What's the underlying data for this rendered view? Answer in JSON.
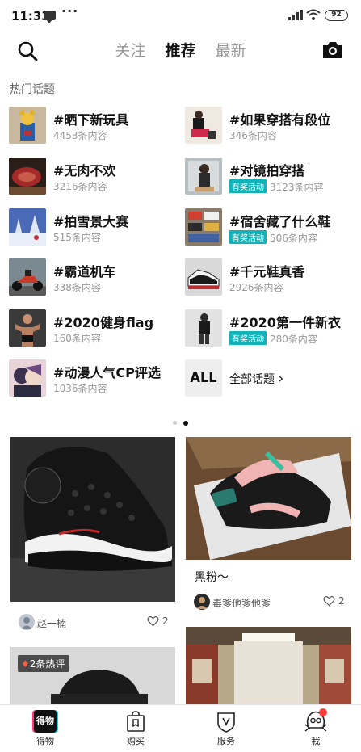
{
  "status_bar": {
    "time": "11:33",
    "dots": "···",
    "battery": "92"
  },
  "header": {
    "tabs": [
      {
        "label": "关注",
        "active": false
      },
      {
        "label": "推荐",
        "active": true
      },
      {
        "label": "最新",
        "active": false
      }
    ]
  },
  "hot_topics": {
    "section_label": "热门话题",
    "items": [
      {
        "title": "#晒下新玩具",
        "count": "4453条内容",
        "reward": ""
      },
      {
        "title": "#如果穿搭有段位",
        "count": "346条内容",
        "reward": ""
      },
      {
        "title": "#无肉不欢",
        "count": "3216条内容",
        "reward": ""
      },
      {
        "title": "#对镜拍穿搭",
        "count": "3123条内容",
        "reward": "有奖活动"
      },
      {
        "title": "#拍雪景大赛",
        "count": "515条内容",
        "reward": ""
      },
      {
        "title": "#宿舍藏了什么鞋",
        "count": "506条内容",
        "reward": "有奖活动"
      },
      {
        "title": "#霸道机车",
        "count": "338条内容",
        "reward": ""
      },
      {
        "title": "#千元鞋真香",
        "count": "2926条内容",
        "reward": ""
      },
      {
        "title": "#2020健身flag",
        "count": "160条内容",
        "reward": ""
      },
      {
        "title": "#2020第一件新衣",
        "count": "280条内容",
        "reward": "有奖活动"
      },
      {
        "title": "#动漫人气CP评选",
        "count": "1036条内容",
        "reward": ""
      }
    ],
    "all": {
      "badge": "ALL",
      "label": "全部话题",
      "chevron": "›"
    }
  },
  "feed": {
    "cards": [
      {
        "caption": "",
        "author": "赵一楠",
        "likes": "2"
      },
      {
        "caption": "黑粉～",
        "author": "毒爹他爹他爹",
        "likes": "2"
      },
      {
        "caption": "",
        "hot_tag": "2条热评"
      }
    ]
  },
  "bottom_nav": {
    "items": [
      {
        "label": "得物",
        "icon": "dewu-logo-icon"
      },
      {
        "label": "购买",
        "icon": "shopping-bag-icon"
      },
      {
        "label": "服务",
        "icon": "shield-v-icon"
      },
      {
        "label": "我",
        "icon": "profile-mascot-icon"
      }
    ],
    "logo_text": "得物"
  }
}
